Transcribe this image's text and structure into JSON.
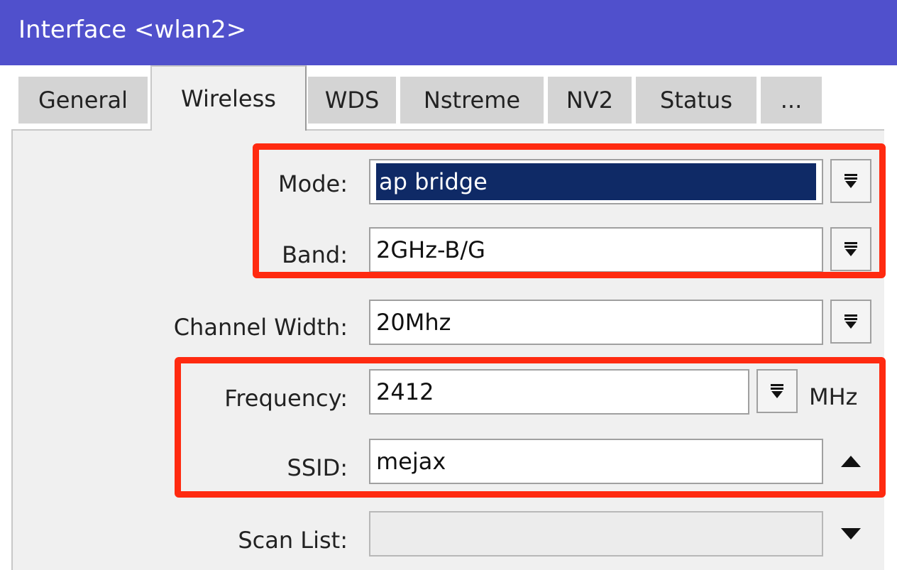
{
  "window": {
    "title": "Interface <wlan2>"
  },
  "tabs": [
    {
      "label": "General",
      "active": false
    },
    {
      "label": "Wireless",
      "active": true
    },
    {
      "label": "WDS",
      "active": false
    },
    {
      "label": "Nstreme",
      "active": false
    },
    {
      "label": "NV2",
      "active": false
    },
    {
      "label": "Status",
      "active": false
    },
    {
      "label": "...",
      "active": false
    }
  ],
  "form": {
    "mode": {
      "label": "Mode:",
      "value": "ap bridge"
    },
    "band": {
      "label": "Band:",
      "value": "2GHz-B/G"
    },
    "channel_width": {
      "label": "Channel Width:",
      "value": "20Mhz"
    },
    "frequency": {
      "label": "Frequency:",
      "value": "2412",
      "unit": "MHz"
    },
    "ssid": {
      "label": "SSID:",
      "value": "mejax"
    },
    "scan_list": {
      "label": "Scan List:",
      "value": ""
    }
  },
  "icons": {
    "dropdown": "dropdown-icon",
    "collapse": "triangle-up-icon",
    "expand": "triangle-down-icon"
  },
  "colors": {
    "titlebar": "#5050cc",
    "highlight": "#ff2a10",
    "selection": "#0f2a66",
    "panel": "#f0f0f0"
  }
}
